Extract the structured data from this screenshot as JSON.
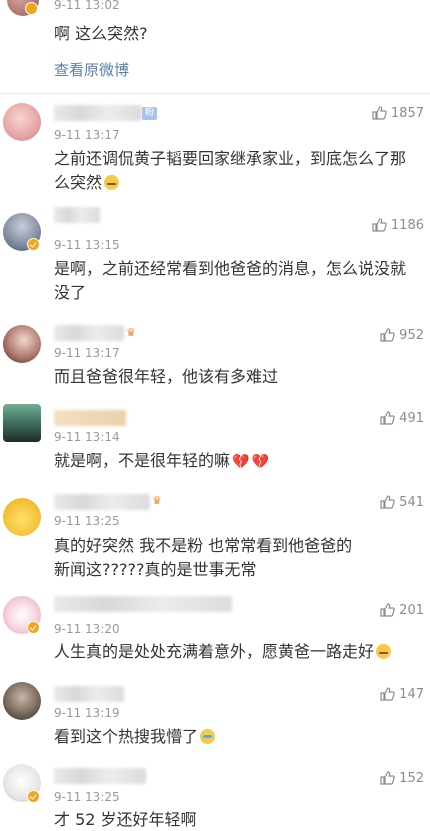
{
  "top": {
    "time": "9-11 13:02",
    "text": "啊 这么突然?",
    "view_original": "查看原微博"
  },
  "comments": [
    {
      "time": "9-11 13:17",
      "likes": "1857",
      "text": "之前还调侃黄子韬要回家继承家业，到底怎么了那么突然",
      "emoji": "sleepy-face"
    },
    {
      "time": "9-11 13:15",
      "likes": "1186",
      "text": "是啊，之前还经常看到他爸爸的消息，怎么说没就没了",
      "emoji": ""
    },
    {
      "time": "9-11 13:17",
      "likes": "952",
      "text": "而且爸爸很年轻，他该有多难过",
      "emoji": ""
    },
    {
      "time": "9-11 13:14",
      "likes": "491",
      "text": "就是啊，不是很年轻的嘛",
      "emoji": "broken-heart"
    },
    {
      "time": "9-11 13:25",
      "likes": "541",
      "text": "真的好突然 我不是粉 也常常看到他爸爸的新闻这?????真的是世事无常",
      "emoji": ""
    },
    {
      "time": "9-11 13:20",
      "likes": "201",
      "text": "人生真的是处处充满着意外，愿黄爸一路走好",
      "emoji": "sleepy-face"
    },
    {
      "time": "9-11 13:19",
      "likes": "147",
      "text": "看到这个热搜我懵了",
      "emoji": "crying-face"
    },
    {
      "time": "9-11 13:25",
      "likes": "152",
      "text": "才 52 岁还好年轻啊",
      "emoji": ""
    }
  ],
  "tags": {
    "fan": "粉"
  },
  "colors": {
    "link": "#5d7fa8",
    "time": "#999999",
    "verified": "#f2a51a"
  }
}
